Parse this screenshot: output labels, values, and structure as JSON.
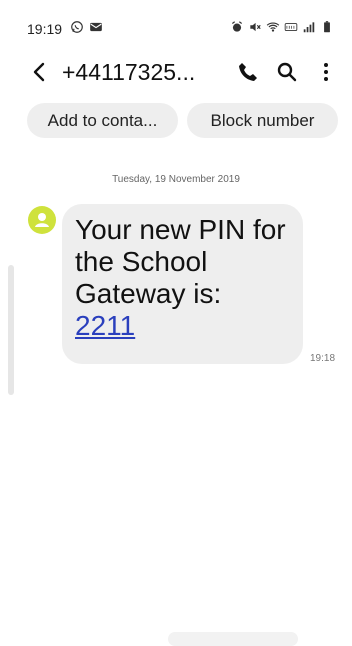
{
  "status_bar": {
    "time": "19:19",
    "icons_left": [
      "whatsapp-icon",
      "mail-icon"
    ],
    "icons_right": [
      "alarm-icon",
      "mute-icon",
      "wifi-icon",
      "volte-icon",
      "signal-icon",
      "battery-icon"
    ]
  },
  "header": {
    "title": "+44117325...",
    "icons": [
      "back-icon",
      "call-icon",
      "search-icon",
      "more-icon"
    ]
  },
  "actions": {
    "add_to_contacts": "Add to conta...",
    "block_number": "Block number"
  },
  "conversation": {
    "date": "Tuesday, 19 November 2019",
    "message": {
      "text": "Your new PIN for the School Gateway is:",
      "pin": "2211",
      "time": "19:18"
    }
  },
  "colors": {
    "bubble_bg": "#eeeeee",
    "avatar_bg": "#cfe23c",
    "link": "#2a3fbd"
  }
}
